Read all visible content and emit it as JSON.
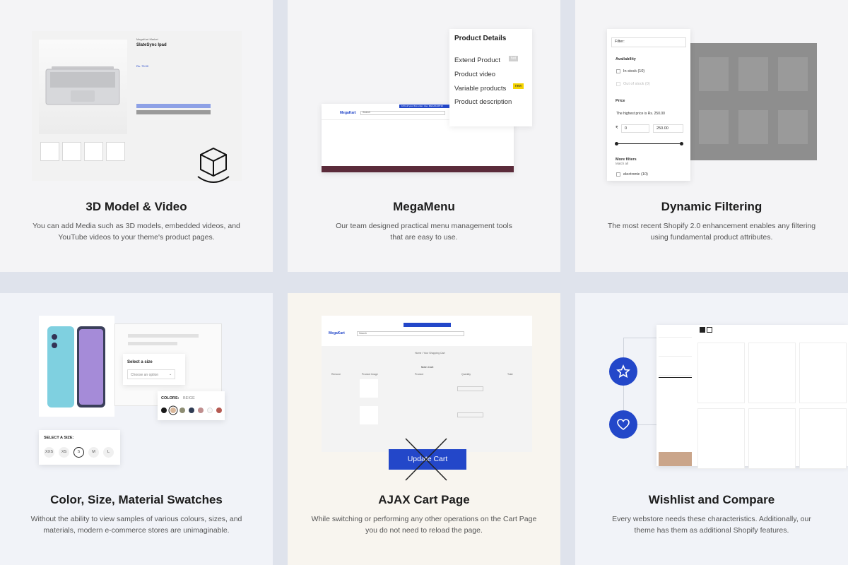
{
  "cards": [
    {
      "title": "3D Model & Video",
      "desc_l1": "You can add Media such as 3D models, embedded videos, and",
      "desc_l2": "YouTube videos to your theme's product pages."
    },
    {
      "title": "MegaMenu",
      "desc_l1": "Our team designed practical menu management tools",
      "desc_l2": "that are easy to use."
    },
    {
      "title": "Dynamic Filtering",
      "desc_l1": "The most recent Shopify 2.0 enhancement enables any filtering",
      "desc_l2": "using fundamental product attributes."
    },
    {
      "title": "Color, Size, Material Swatches",
      "desc_l1": "Without the ability to view samples of various colours, sizes, and",
      "desc_l2": "materials, modern e-commerce stores are unimaginable."
    },
    {
      "title": "AJAX Cart Page",
      "desc_l1": "While switching or performing any other operations on the Cart Page",
      "desc_l2": "you do not need to reload the page."
    },
    {
      "title": "Wishlist and Compare",
      "desc_l1": "Every webstore needs these characteristics. Additionally, our",
      "desc_l2": "theme has them as additional Shopify features."
    }
  ],
  "product_page": {
    "vendor": "MegaKart Market",
    "product_name": "SlateSync Ipad",
    "price": "Rs. 75.00"
  },
  "megamenu": {
    "panel_title": "Product Details",
    "items": [
      "Extend Product",
      "Product video",
      "Variable products",
      "Product description"
    ],
    "hot_tag": "hot",
    "new_tag": "new",
    "logo": "MegaKart",
    "promo": "10% off your first order. Use: MEGAKART10",
    "search": "Search"
  },
  "filter": {
    "placeholder": "Filter:",
    "availability": "Availability",
    "in_stock": "In stock (10)",
    "out_of_stock": "Out of stock (0)",
    "price": "Price",
    "highest_price": "The highest price is Rs. 250.00",
    "currency": "₹",
    "min": "0",
    "max": "250.00",
    "more_filters": "More filters",
    "match_all": "Match all",
    "electronic": "electronic (10)"
  },
  "swatches": {
    "select_size": "Select a size",
    "choose_option": "Choose an option",
    "colors_label": "COLORS:",
    "colors_value": "BEIGE",
    "colors": [
      "#1a1a1a",
      "#d9b79a",
      "#8d8d73",
      "#2f3b53",
      "#c08f8f",
      "#f7f7f7",
      "#b55a52"
    ],
    "select_a_size": "SELECT A SIZE:",
    "sizes": [
      "XXS",
      "XS",
      "S",
      "M",
      "L"
    ],
    "selected_size": "S"
  },
  "cart": {
    "page_title": "Main Cart",
    "breadcrumb": "Home  /  Your Shopping Cart",
    "columns": [
      "Remove",
      "Product Image",
      "Product",
      "Quantity",
      "Total"
    ],
    "update_button": "Update Cart"
  },
  "colors": {
    "accent": "#2347c9"
  }
}
